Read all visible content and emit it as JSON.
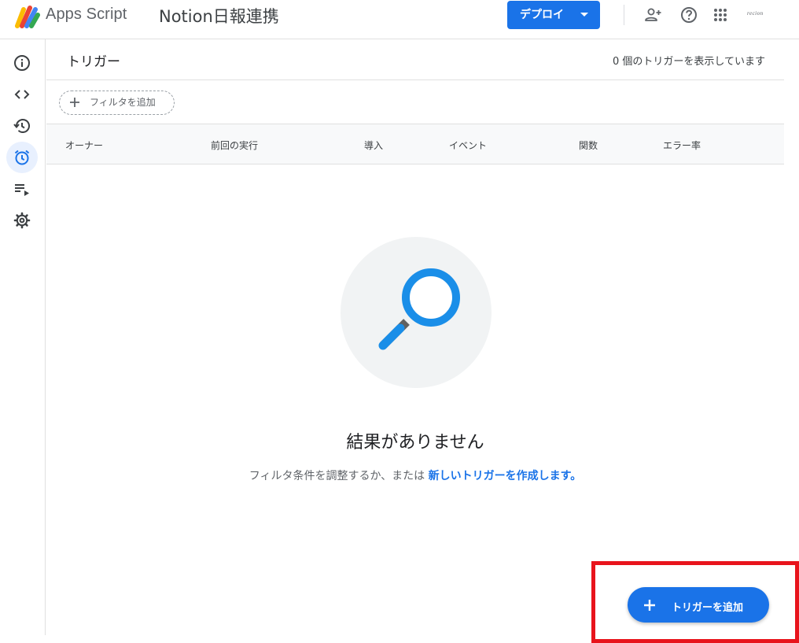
{
  "header": {
    "app_name": "Apps Script",
    "project_name": "Notion日報連携",
    "deploy_label": "デプロイ",
    "account_label": "recion",
    "icons": [
      "add-person-icon",
      "help-icon",
      "apps-grid-icon"
    ]
  },
  "sidebar": {
    "items": [
      {
        "name": "overview",
        "icon": "info-icon",
        "active": false
      },
      {
        "name": "editor",
        "icon": "code-icon",
        "active": false
      },
      {
        "name": "executions",
        "icon": "history-icon",
        "active": false
      },
      {
        "name": "triggers",
        "icon": "alarm-clock-icon",
        "active": true
      },
      {
        "name": "executions-log",
        "icon": "playlist-play-icon",
        "active": false
      },
      {
        "name": "settings",
        "icon": "gear-icon",
        "active": false
      }
    ]
  },
  "main": {
    "title": "トリガー",
    "trigger_count_text": "0 個のトリガーを表示しています",
    "filter_label": "フィルタを追加",
    "columns": [
      "オーナー",
      "前回の実行",
      "導入",
      "イベント",
      "関数",
      "エラー率"
    ],
    "empty_title": "結果がありません",
    "empty_desc_prefix": "フィルタ条件を調整するか、または",
    "empty_desc_link": "新しいトリガーを作成します。"
  },
  "fab": {
    "label": "トリガーを追加"
  },
  "colors": {
    "accent": "#1a73e8",
    "active_nav_bg": "#e8f0fe",
    "highlight_border": "#e8141c",
    "magnifier": "#1a8ee8"
  }
}
